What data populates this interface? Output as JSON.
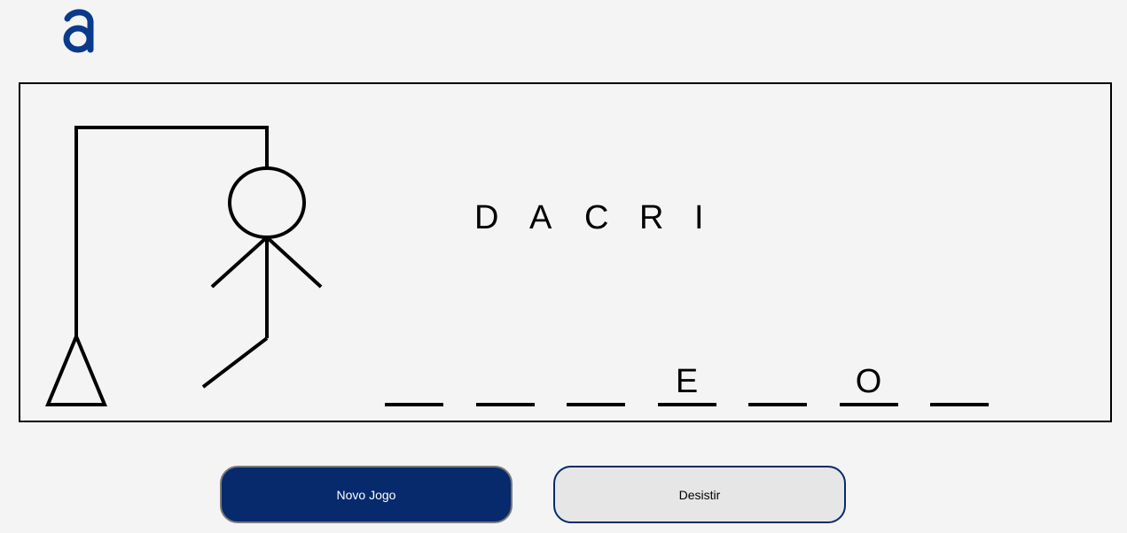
{
  "logo": {
    "glyph": "a",
    "color": "#0a3a8c"
  },
  "game": {
    "wrong_letters": [
      "D",
      "A",
      "C",
      "R",
      "I"
    ],
    "word_slots": [
      "",
      "",
      "",
      "E",
      "",
      "O",
      ""
    ],
    "hangman_parts_drawn": [
      "gallows",
      "head",
      "body",
      "left-arm",
      "right-arm",
      "left-leg"
    ]
  },
  "buttons": {
    "new_game": "Novo Jogo",
    "give_up": "Desistir"
  },
  "colors": {
    "primary": "#062a6c",
    "background": "#f4f4f4",
    "secondary_button": "#e6e6e6"
  }
}
